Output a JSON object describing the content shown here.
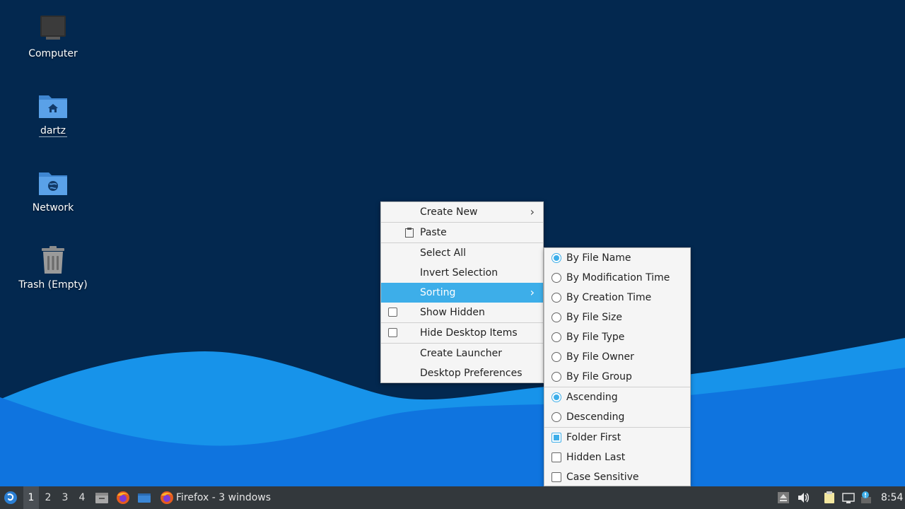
{
  "desktop": {
    "icons": [
      {
        "label": "Computer"
      },
      {
        "label": "dartz"
      },
      {
        "label": "Network"
      },
      {
        "label": "Trash (Empty)"
      }
    ]
  },
  "context_menu": {
    "items": [
      {
        "label": "Create New"
      },
      {
        "label": "Paste"
      },
      {
        "label": "Select All"
      },
      {
        "label": "Invert Selection"
      },
      {
        "label": "Sorting"
      },
      {
        "label": "Show Hidden"
      },
      {
        "label": "Hide Desktop Items"
      },
      {
        "label": "Create Launcher"
      },
      {
        "label": "Desktop Preferences"
      }
    ],
    "show_hidden_checked": false,
    "hide_desktop_items_checked": false
  },
  "sorting_menu": {
    "sort_by": [
      {
        "label": "By File Name",
        "selected": true
      },
      {
        "label": "By Modification Time",
        "selected": false
      },
      {
        "label": "By Creation Time",
        "selected": false
      },
      {
        "label": "By File Size",
        "selected": false
      },
      {
        "label": "By File Type",
        "selected": false
      },
      {
        "label": "By File Owner",
        "selected": false
      },
      {
        "label": "By File Group",
        "selected": false
      }
    ],
    "order": [
      {
        "label": "Ascending",
        "selected": true
      },
      {
        "label": "Descending",
        "selected": false
      }
    ],
    "options": [
      {
        "label": "Folder First",
        "checked": true
      },
      {
        "label": "Hidden Last",
        "checked": false
      },
      {
        "label": "Case Sensitive",
        "checked": false
      }
    ]
  },
  "taskbar": {
    "workspaces": [
      "1",
      "2",
      "3",
      "4"
    ],
    "active_workspace": "1",
    "task_label": "Firefox - 3 windows",
    "clock": "8:54"
  },
  "colors": {
    "accent": "#3daee9",
    "desktop_bg": "#03284f",
    "taskbar_bg": "#33383c"
  }
}
